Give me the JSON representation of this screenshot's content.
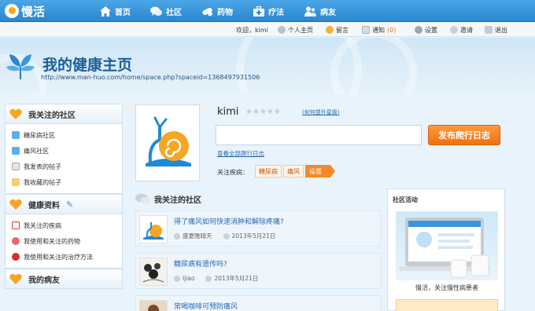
{
  "logo": {
    "text": "慢活"
  },
  "nav": [
    {
      "label": "首页",
      "icon": "home-icon"
    },
    {
      "label": "社区",
      "icon": "chat-bubble-icon"
    },
    {
      "label": "药物",
      "icon": "pill-icon"
    },
    {
      "label": "疗法",
      "icon": "medical-kit-icon"
    },
    {
      "label": "病友",
      "icon": "users-icon"
    }
  ],
  "userbar": {
    "welcome": "欢迎，kimi",
    "home": "个人主页",
    "messages": "留言",
    "notifications": "通知",
    "notify_count": "(0)",
    "settings": "设置",
    "invite": "邀请",
    "logout": "退出"
  },
  "header": {
    "title": "我的健康主页",
    "url": "http://www.man-huo.com/home/space.php?spaceid=1368497931506"
  },
  "sidebar": {
    "communities": {
      "title": "我关注的社区",
      "items": [
        {
          "label": "糖尿病社区",
          "icon": "community-icon"
        },
        {
          "label": "痛风社区",
          "icon": "community-icon"
        },
        {
          "label": "我发表的帖子",
          "icon": "document-icon"
        },
        {
          "label": "我收藏的帖子",
          "icon": "folder-icon"
        }
      ]
    },
    "health": {
      "title": "健康资料",
      "items": [
        {
          "label": "我关注的疾病",
          "icon": "medical-cross-icon"
        },
        {
          "label": "我使用和关注的药物",
          "icon": "pill-icon"
        },
        {
          "label": "我使用和关注的治疗方法",
          "icon": "heart-icon"
        }
      ]
    },
    "friends": {
      "title": "我的病友"
    }
  },
  "profile": {
    "username": "kimi",
    "stars": "★★★★★",
    "upgrade_link": "(如何提升星级)",
    "diary_placeholder": "",
    "post_button": "发布爬行日志",
    "view_all": "查看全部爬行日志",
    "disease_label": "关注疾病：",
    "tags": [
      "糖尿病",
      "痛风"
    ],
    "settings_tag": "设置"
  },
  "feed": {
    "title": "我关注的社区",
    "posts": [
      {
        "title": "得了痛风如何快速消肿和解除疼痛?",
        "author": "盛夏晚晴天",
        "date": "2013年5月21日"
      },
      {
        "title": "糖尿病有遗传吗?",
        "author": "ljiao",
        "date": "2013年5月21日"
      },
      {
        "title": "常喝咖啡可预防痛风",
        "author": "",
        "date": ""
      }
    ]
  },
  "activity": {
    "title": "社区活动",
    "caption": "慢活，关注慢性病患者"
  },
  "colors": {
    "nav_bg": "#2b86cf",
    "accent_orange": "#f06f0f",
    "link_blue": "#2a6ab4"
  }
}
